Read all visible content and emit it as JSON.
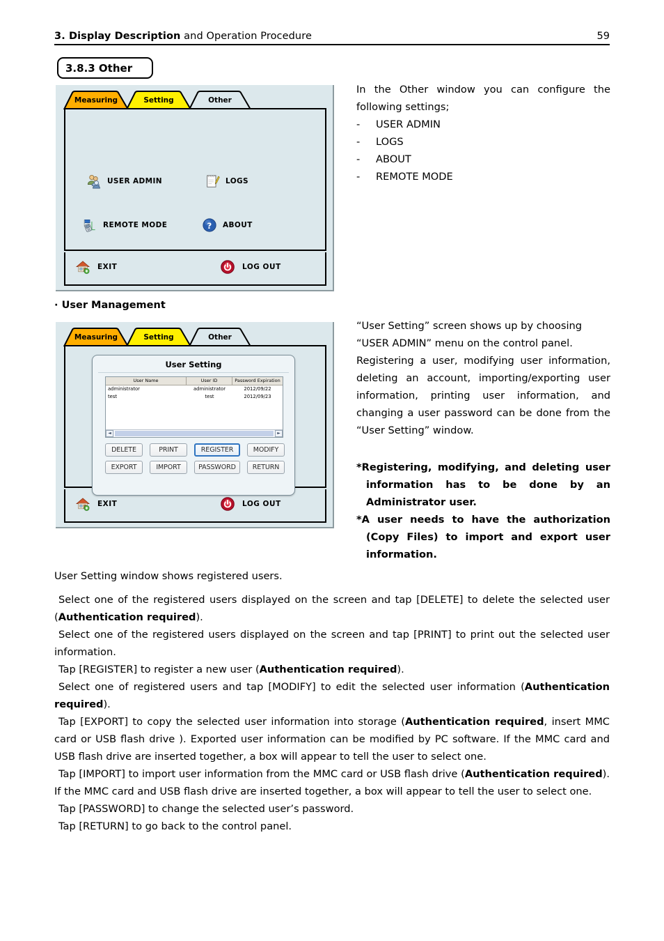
{
  "header": {
    "title_bold": "3. Display Description",
    "title_rest": " and Operation Procedure",
    "page_number": "59"
  },
  "section": {
    "number_title": "3.8.3 Other"
  },
  "subsection": {
    "bullet": "·",
    "title": "User Management"
  },
  "device_other": {
    "tabs": [
      {
        "label": "Measuring",
        "color": "#FFAE00",
        "active": false
      },
      {
        "label": "Setting",
        "color": "#FFF000",
        "active": false
      },
      {
        "label": "Other",
        "color": "#DCE8EC",
        "active": true
      }
    ],
    "menu_items": [
      {
        "label": "USER ADMIN",
        "icon": "users-icon"
      },
      {
        "label": "LOGS",
        "icon": "notepad-pencil-icon"
      },
      {
        "label": "REMOTE MODE",
        "icon": "remote-device-icon"
      },
      {
        "label": "ABOUT",
        "icon": "question-mark-icon"
      }
    ],
    "footer_items": [
      {
        "label": "EXIT",
        "icon": "house-icon"
      },
      {
        "label": "LOG OUT",
        "icon": "power-icon"
      }
    ]
  },
  "device_user_setting": {
    "tabs": [
      {
        "label": "Measuring",
        "color": "#FFAE00",
        "active": false
      },
      {
        "label": "Setting",
        "color": "#FFF000",
        "active": false
      },
      {
        "label": "Other",
        "color": "#DCE8EC",
        "active": true
      }
    ],
    "footer_items": [
      {
        "label": "EXIT",
        "icon": "house-icon"
      },
      {
        "label": "LOG OUT",
        "icon": "power-icon"
      }
    ],
    "dialog": {
      "title": "User Setting",
      "columns": [
        "User Name",
        "User ID",
        "Password Expiration"
      ],
      "rows": [
        {
          "user_name": "administrator",
          "user_id": "administrator",
          "password_expiration": "2012/09/22"
        },
        {
          "user_name": "test",
          "user_id": "test",
          "password_expiration": "2012/09/23"
        }
      ],
      "scrollbar": {
        "left_arrow": "◄",
        "right_arrow": "►"
      },
      "buttons": [
        {
          "label": "DELETE",
          "focused": false
        },
        {
          "label": "PRINT",
          "focused": false
        },
        {
          "label": "REGISTER",
          "focused": true
        },
        {
          "label": "MODIFY",
          "focused": false
        },
        {
          "label": "EXPORT",
          "focused": false
        },
        {
          "label": "IMPORT",
          "focused": false
        },
        {
          "label": "PASSWORD",
          "focused": false
        },
        {
          "label": "RETURN",
          "focused": false
        }
      ]
    }
  },
  "right_column_1": {
    "intro": "In the Other window you can configure the following settings;",
    "items": [
      {
        "dash": "-",
        "label": "USER ADMIN"
      },
      {
        "dash": "-",
        "label": "LOGS"
      },
      {
        "dash": "-",
        "label": "ABOUT"
      },
      {
        "dash": "-",
        "label": "REMOTE MODE"
      }
    ]
  },
  "right_column_2": {
    "paragraph_1": "“User Setting” screen shows up by choosing “USER ADMIN” menu on the control panel.",
    "paragraph_2": "Registering a user, modifying user information, deleting an account, importing/exporting user information, printing user information, and changing a user password can be done from the “User Setting” window."
  },
  "right_column_3": {
    "note_1_star": "*",
    "note_1": "Registering, modifying, and deleting user information has to be done by an Administrator user.",
    "note_2_star": "*",
    "note_2": "A user needs to have the authorization (Copy Files) to import and export user information."
  },
  "body": {
    "intro": "User Setting window shows registered users.",
    "p1_a": "Select one of the registered users displayed on the screen and tap [DELETE] to delete the selected user (",
    "p1_b": "Authentication required",
    "p1_c": ").",
    "p2": "Select one of the registered users displayed on the screen and tap [PRINT] to print out the selected user information.",
    "p3_a": "Tap [REGISTER] to register a new user (",
    "p3_b": "Authentication required",
    "p3_c": ").",
    "p4_a": "Select one of registered users and tap [MODIFY] to edit the selected user information (",
    "p4_b": "Authentication required",
    "p4_c": ").",
    "p5_a": "Tap [EXPORT] to copy the selected user information into storage (",
    "p5_b": "Authentication required",
    "p5_c": ", insert MMC card or USB flash drive ). Exported user information can be modified by PC software. If the MMC card and USB flash drive are inserted together,  a box will appear to tell the user to select one.",
    "p6_a": "Tap [IMPORT] to import user information from the MMC card or USB flash drive (",
    "p6_b": "Authentication required",
    "p6_c": "). If the MMC card and USB flash drive are inserted together, a box will appear to tell the user to select one.",
    "p7": "Tap [PASSWORD] to change the selected user’s password.",
    "p8": "Tap [RETURN] to go back to the control panel."
  }
}
